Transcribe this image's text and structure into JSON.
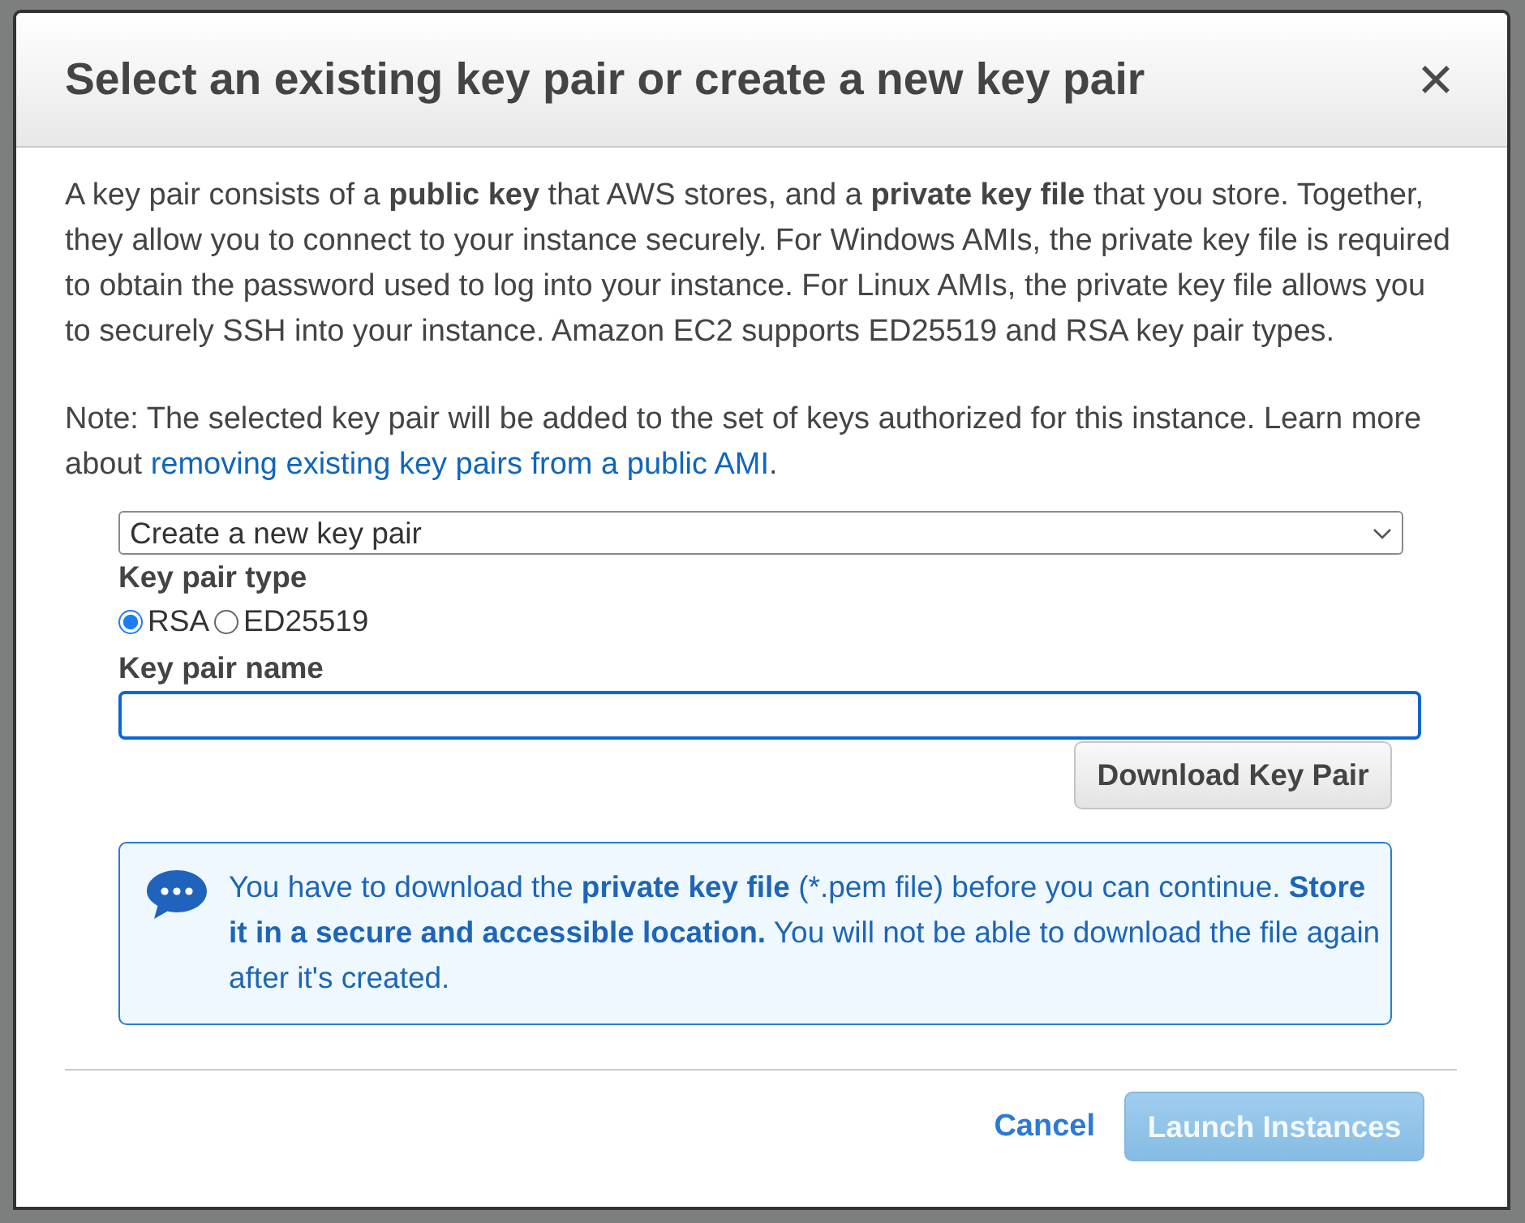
{
  "dialog": {
    "title": "Select an existing key pair or create a new key pair"
  },
  "intro": "A key pair consists of a **public key** that AWS stores, and a **private key file** that you store. Together, they allow you to connect to your instance securely. For Windows AMIs, the private key file is required to obtain the password used to log into your instance. For Linux AMIs, the private key file allows you to securely SSH into your instance. Amazon EC2 supports ED25519 and RSA key pair types.",
  "note": {
    "text": "Note: The selected key pair will be added to the set of keys authorized for this instance. Learn more about",
    "link": "removing existing key pairs from a public AMI",
    "tail": "."
  },
  "key_pair_select": {
    "value": "Create a new key pair"
  },
  "key_pair_type": {
    "label": "Key pair type",
    "options": [
      {
        "label": "RSA",
        "selected": true
      },
      {
        "label": "ED25519",
        "selected": false
      }
    ]
  },
  "key_pair_name": {
    "label": "Key pair name",
    "focused": true
  },
  "download_button": {
    "label": "Download Key Pair"
  },
  "info_box": {
    "text": "You have to download the **private key file** (*.pem file) before you can continue. **Store it in a secure and accessible location.** You will not be able to download the file again after it's created."
  },
  "footer": {
    "cancel": "Cancel",
    "primary": {
      "label": "Launch Instances",
      "disabled": true
    }
  }
}
